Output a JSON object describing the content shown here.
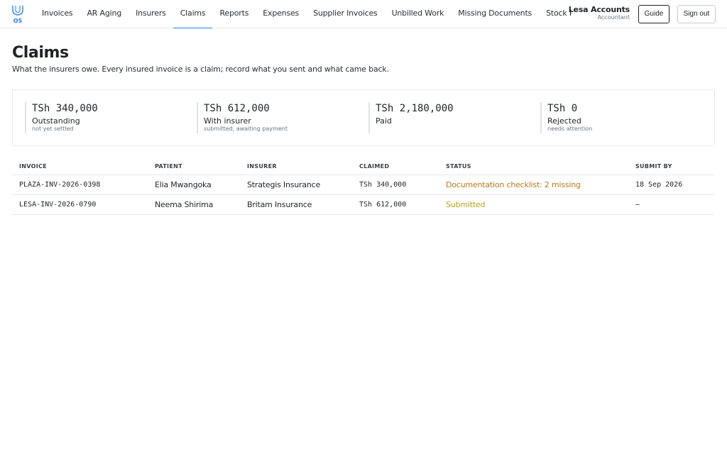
{
  "app": {
    "logo_text": "OS"
  },
  "nav": {
    "items": [
      {
        "label": "Invoices",
        "active": false
      },
      {
        "label": "AR Aging",
        "active": false
      },
      {
        "label": "Insurers",
        "active": false
      },
      {
        "label": "Claims",
        "active": true
      },
      {
        "label": "Reports",
        "active": false
      },
      {
        "label": "Expenses",
        "active": false
      },
      {
        "label": "Supplier Invoices",
        "active": false
      },
      {
        "label": "Unbilled Work",
        "active": false
      },
      {
        "label": "Missing Documents",
        "active": false
      },
      {
        "label": "Stock Report",
        "active": false
      },
      {
        "label": "R",
        "active": false
      }
    ]
  },
  "user": {
    "name": "Lesa Accounts",
    "role": "Accountant"
  },
  "buttons": {
    "guide": "Guide",
    "sign_out": "Sign out"
  },
  "header": {
    "title": "Claims",
    "subtitle": "What the insurers owe. Every insured invoice is a claim; record what you sent and what came back."
  },
  "summary": [
    {
      "value": "TSh 340,000",
      "label": "Outstanding",
      "note": "not yet settled"
    },
    {
      "value": "TSh 612,000",
      "label": "With insurer",
      "note": "submitted, awaiting payment"
    },
    {
      "value": "TSh 2,180,000",
      "label": "Paid",
      "note": ""
    },
    {
      "value": "TSh 0",
      "label": "Rejected",
      "note": "needs attention"
    }
  ],
  "table": {
    "headers": {
      "invoice": "Invoice",
      "patient": "Patient",
      "insurer": "Insurer",
      "claimed": "Claimed",
      "status": "Status",
      "submit_by": "Submit by"
    },
    "rows": [
      {
        "invoice": "PLAZA-INV-2026-0398",
        "patient": "Elia Mwangoka",
        "insurer": "Strategis Insurance",
        "claimed": "TSh 340,000",
        "status": "Documentation checklist: 2 missing",
        "submit_by": "18 Sep 2026"
      },
      {
        "invoice": "LESA-INV-2026-0790",
        "patient": "Neema Shirima",
        "insurer": "Britam Insurance",
        "claimed": "TSh 612,000",
        "status": "Submitted",
        "submit_by": "—"
      }
    ]
  },
  "colors": {
    "accent": "#2f7ee8",
    "warning": "#b7791f",
    "submitted": "#b7a21f"
  }
}
